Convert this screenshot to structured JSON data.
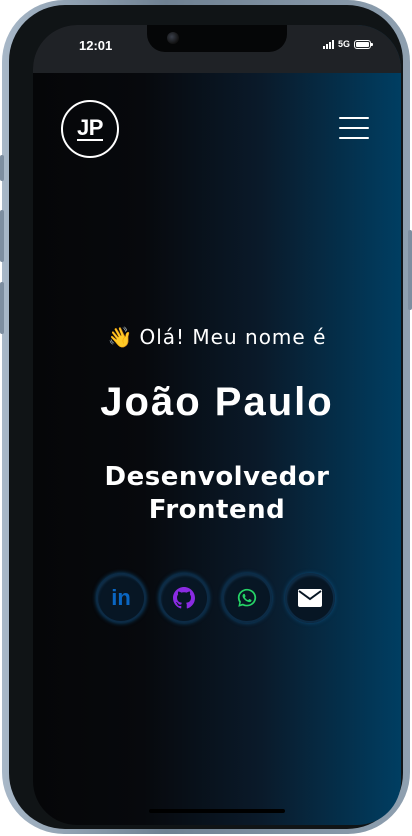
{
  "status_bar": {
    "time": "12:01",
    "network": "5G"
  },
  "header": {
    "logo_text": "JP",
    "menu_icon": "hamburger-menu-icon"
  },
  "hero": {
    "greeting_emoji": "👋",
    "greeting": "Olá! Meu nome é",
    "name": "João Paulo",
    "role_line1": "Desenvolvedor",
    "role_line2": "Frontend"
  },
  "social_links": [
    {
      "icon": "linkedin-icon",
      "text": "in",
      "color": "#0a66c2"
    },
    {
      "icon": "github-icon",
      "color": "#8a2be2"
    },
    {
      "icon": "whatsapp-icon",
      "color": "#25d366"
    },
    {
      "icon": "email-icon",
      "color": "#ffffff"
    }
  ],
  "colors": {
    "background_start": "#050608",
    "background_end": "#003e62",
    "text": "#ffffff"
  }
}
